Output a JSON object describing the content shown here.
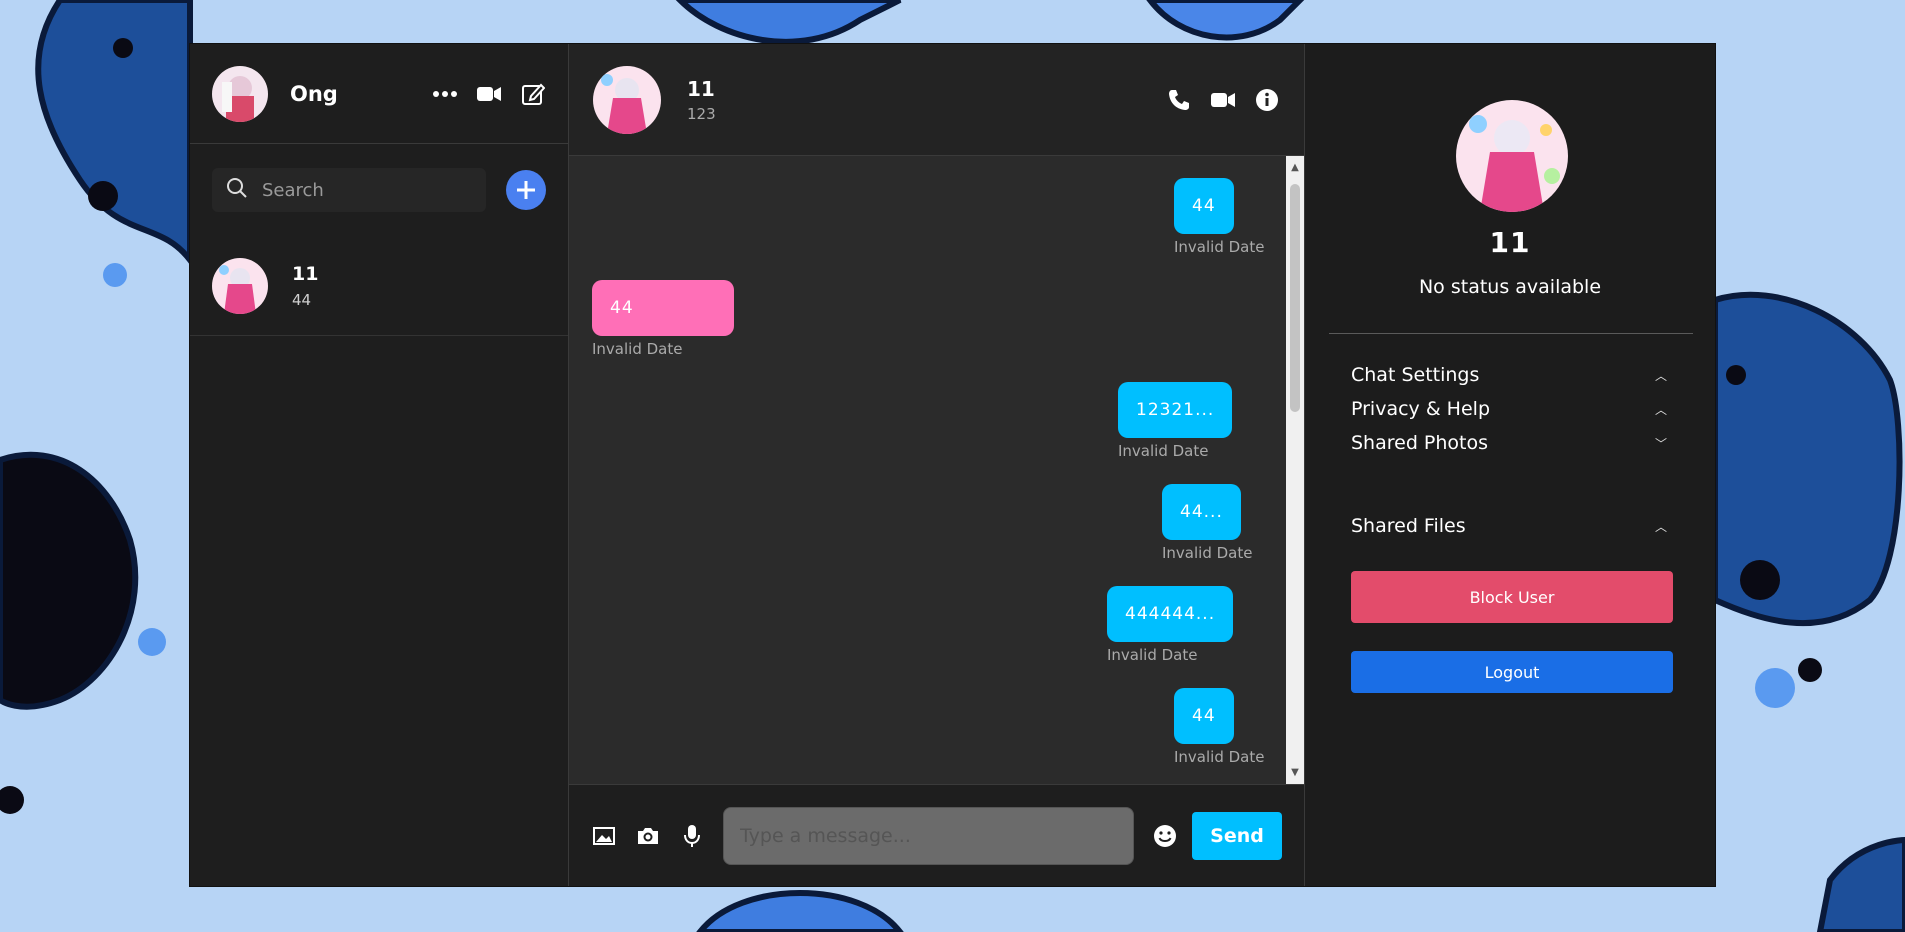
{
  "colors": {
    "outgoing_bubble": "#00bfff",
    "incoming_bubble": "#ff6fb7",
    "add_button": "#4a80f0",
    "send_button": "#00bfff",
    "block_button": "#e34c6b",
    "logout_button": "#1a6ee6"
  },
  "left_panel": {
    "user_name": "Ong",
    "header_icons": [
      "more-horizontal-icon",
      "video-camera-icon",
      "compose-icon"
    ],
    "search": {
      "placeholder": "Search"
    },
    "conversations": [
      {
        "name": "11",
        "last_message": "44"
      }
    ]
  },
  "chat": {
    "contact_name": "11",
    "contact_sub": "123",
    "header_icons": [
      "phone-icon",
      "video-camera-icon",
      "info-icon"
    ],
    "messages": [
      {
        "direction": "out",
        "text": "44",
        "date": "Invalid Date"
      },
      {
        "direction": "in",
        "text": "44",
        "date": "Invalid Date"
      },
      {
        "direction": "out",
        "text": "12321...",
        "date": "Invalid Date"
      },
      {
        "direction": "out",
        "text": "44...",
        "date": "Invalid Date"
      },
      {
        "direction": "out",
        "text": "444444...",
        "date": "Invalid Date"
      },
      {
        "direction": "out",
        "text": "44",
        "date": "Invalid Date"
      }
    ],
    "composer": {
      "icons": [
        "image-icon",
        "camera-icon",
        "microphone-icon",
        "emoji-icon"
      ],
      "placeholder": "Type a message...",
      "send_label": "Send"
    }
  },
  "right_panel": {
    "name": "11",
    "status": "No status available",
    "sections": [
      {
        "label": "Chat Settings",
        "state": "collapsed-up"
      },
      {
        "label": "Privacy & Help",
        "state": "collapsed-up"
      },
      {
        "label": "Shared Photos",
        "state": "expanded-down"
      },
      {
        "label": "Shared Files",
        "state": "collapsed-up"
      }
    ],
    "block_label": "Block User",
    "logout_label": "Logout"
  }
}
